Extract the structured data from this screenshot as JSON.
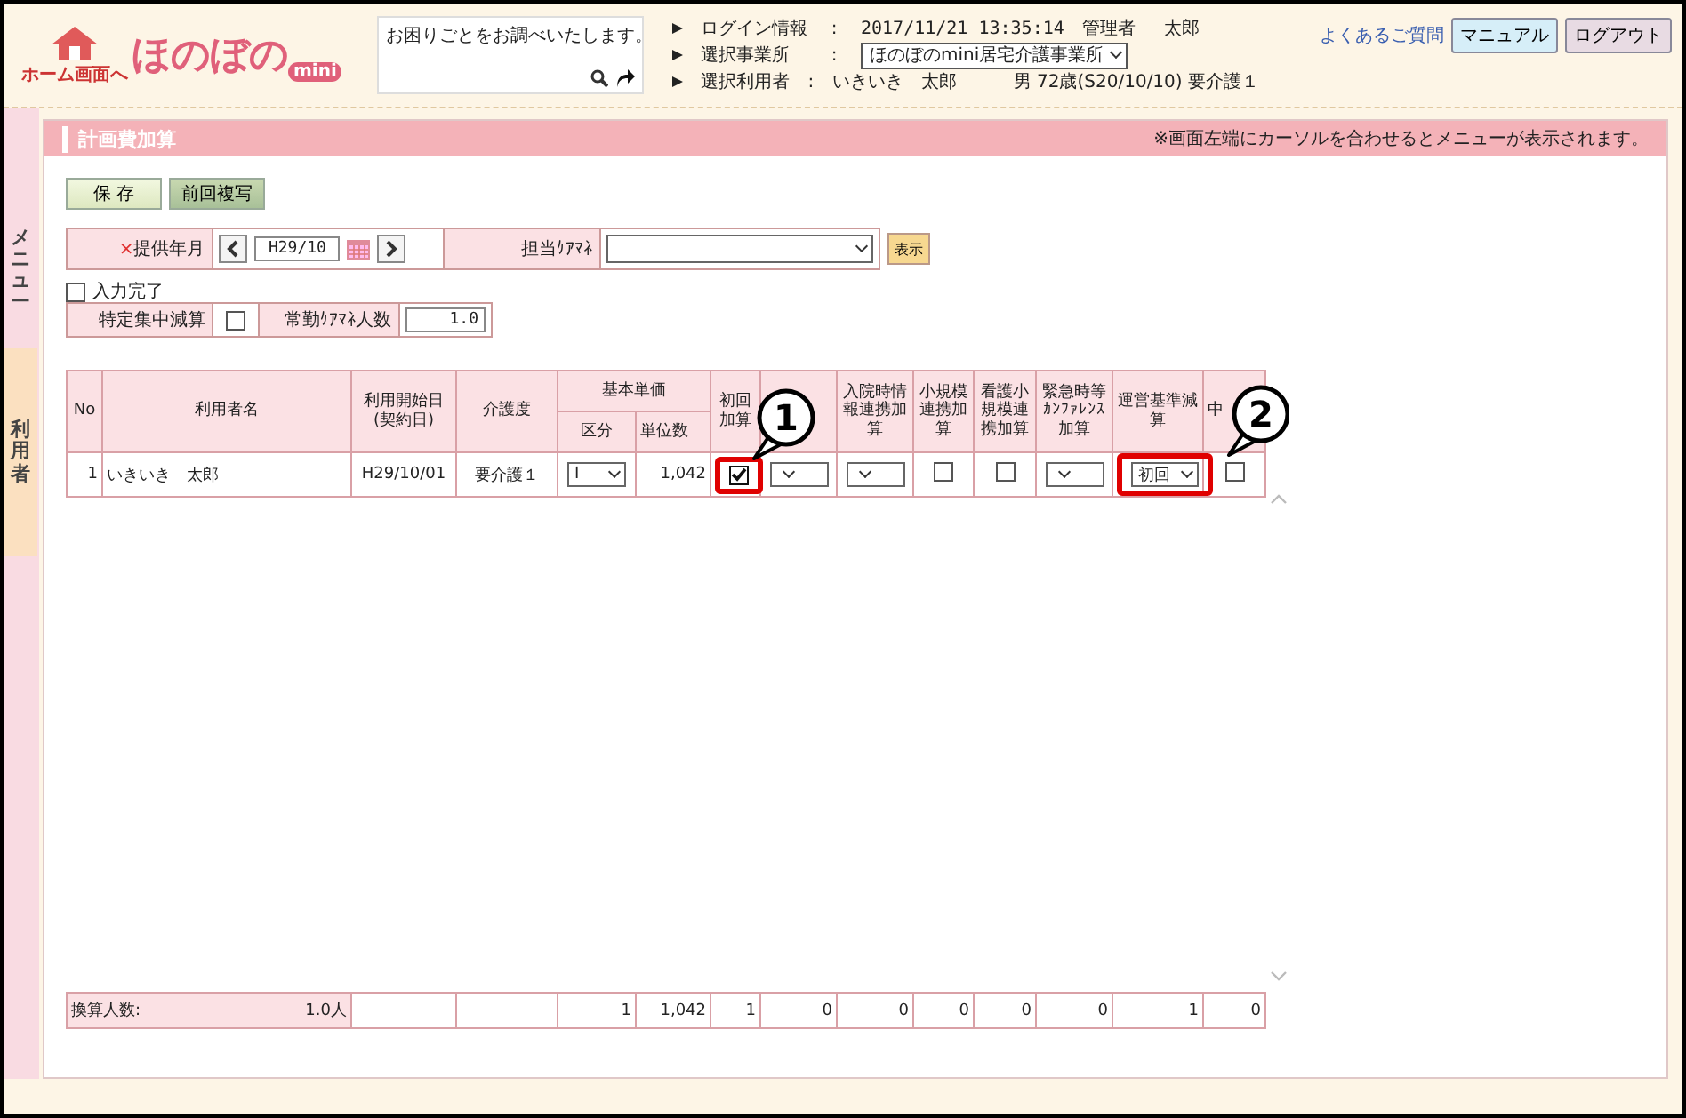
{
  "header": {
    "home_label": "ホーム画面へ",
    "logo_text": "ほのぼの",
    "logo_badge": "mini",
    "search": {
      "placeholder": "お困りごとをお調べいたします。"
    },
    "info": [
      {
        "label": "ログイン情報",
        "separator": ":",
        "value": "2017/11/21 13:35:14　管理者　 太郎",
        "kind": "text"
      },
      {
        "label": "選択事業所",
        "separator": ":",
        "value": "ほのぼのmini居宅介護事業所",
        "kind": "select"
      },
      {
        "label": "選択利用者",
        "separator": ":",
        "value": "いきいき　太郎",
        "extra": "男 72歳(S20/10/10) 要介護１",
        "kind": "text"
      }
    ],
    "links": [
      {
        "label": "よくあるご質問",
        "kind": "link"
      },
      {
        "label": "マニュアル",
        "kind": "manual"
      },
      {
        "label": "ログアウト",
        "kind": "logout"
      }
    ]
  },
  "side_tabs": [
    {
      "label": "メニュー",
      "selected": false
    },
    {
      "label": "利用者",
      "selected": true
    }
  ],
  "panel": {
    "title": "計画費加算",
    "notice": "※画面左端にカーソルを合わせるとメニューが表示されます。"
  },
  "buttons": [
    {
      "label": "保 存",
      "kind": "save"
    },
    {
      "label": "前回複写",
      "kind": "copy"
    }
  ],
  "filters": {
    "required_mark": "×",
    "month_label": "提供年月",
    "month_value": "H29/10",
    "manager_label": "担当ｹｱﾏﾈ",
    "show_button": "表示"
  },
  "input_complete": {
    "label": "入力完了",
    "checked": false
  },
  "reduction": {
    "label": "特定集中減算",
    "checked": false,
    "staff_label": "常勤ｹｱﾏﾈ人数",
    "staff_value": "1.0"
  },
  "table": {
    "group_label": "基本単価",
    "columns": [
      {
        "label": "No",
        "kind": "plain"
      },
      {
        "label": "利用者名",
        "kind": "plain"
      },
      {
        "label": "利用開始日\n(契約日)",
        "kind": "plain"
      },
      {
        "label": "介護度",
        "kind": "plain"
      },
      {
        "label": "区分",
        "kind": "grouped"
      },
      {
        "label": "単位数",
        "kind": "grouped"
      },
      {
        "label": "初回加算",
        "kind": "plain"
      },
      {
        "kind": "plain"
      },
      {
        "label": "入院時情報連携加算",
        "kind": "plain"
      },
      {
        "label": "小規模連携加算",
        "kind": "plain"
      },
      {
        "label": "看護小規模連携加算",
        "kind": "plain"
      },
      {
        "label": "緊急時等ｶﾝﾌｧﾚﾝｽ加算",
        "kind": "plain"
      },
      {
        "label": "運営基準減算",
        "kind": "plain"
      },
      {
        "label": "中",
        "kind": "plain"
      }
    ],
    "rows": [
      {
        "cells": [
          {
            "kind": "number",
            "value": "1"
          },
          {
            "kind": "text",
            "value": "いきいき　太郎"
          },
          {
            "kind": "center",
            "value": "H29/10/01"
          },
          {
            "kind": "center",
            "value": "要介護１"
          },
          {
            "kind": "select",
            "value": "Ⅰ"
          },
          {
            "kind": "number",
            "value": "1,042"
          },
          {
            "kind": "check",
            "checked": true,
            "callout": "1"
          },
          {
            "kind": "select"
          },
          {
            "kind": "select"
          },
          {
            "kind": "check",
            "checked": false
          },
          {
            "kind": "check",
            "checked": false
          },
          {
            "kind": "select"
          },
          {
            "kind": "select",
            "value": "初回",
            "callout": "2"
          },
          {
            "kind": "check",
            "checked": false
          }
        ]
      }
    ],
    "footer": {
      "label": "換算人数:",
      "value": "1.0人",
      "cells": [
        "1",
        "1,042",
        "1",
        "0",
        "0",
        "0",
        "0",
        "0",
        "1",
        "0"
      ]
    }
  }
}
